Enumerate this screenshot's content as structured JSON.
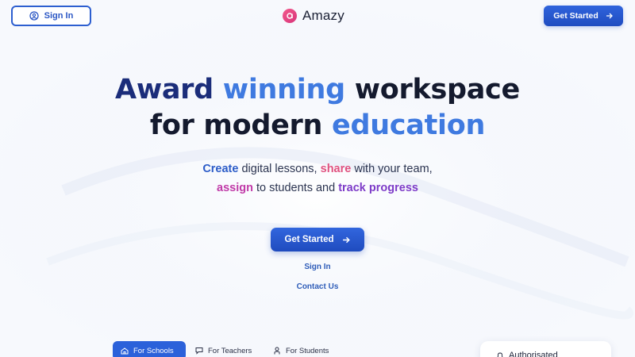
{
  "header": {
    "signin_label": "Sign In",
    "brand": "Amazy",
    "get_started_label": "Get Started"
  },
  "hero": {
    "line1_part1": "Award",
    "line1_part2": "winning",
    "line1_part3": "workspace",
    "line2_part1": "for modern",
    "line2_part2": "education",
    "sub_create": "Create",
    "sub_t1": " digital lessons, ",
    "sub_share": "share",
    "sub_t2": " with your team,",
    "sub_assign": "assign",
    "sub_t3": " to students and ",
    "sub_track": "track progress",
    "cta_label": "Get Started",
    "signin_link": "Sign In",
    "contact_link": "Contact Us"
  },
  "tabs": [
    {
      "label": "For Schools",
      "icon": "school-icon",
      "active": true
    },
    {
      "label": "For Teachers",
      "icon": "chat-board-icon",
      "active": false
    },
    {
      "label": "For Students",
      "icon": "student-icon",
      "active": false
    }
  ],
  "card": {
    "text": "Authorisated",
    "icon": "bell-icon"
  },
  "colors": {
    "primary": "#2b61da",
    "navy": "#1b2d7a",
    "accent_blue": "#3f7ae0",
    "pink": "#e0517f",
    "magenta": "#c03aa8",
    "purple": "#7d3bc8",
    "logo": "#e0427f"
  }
}
